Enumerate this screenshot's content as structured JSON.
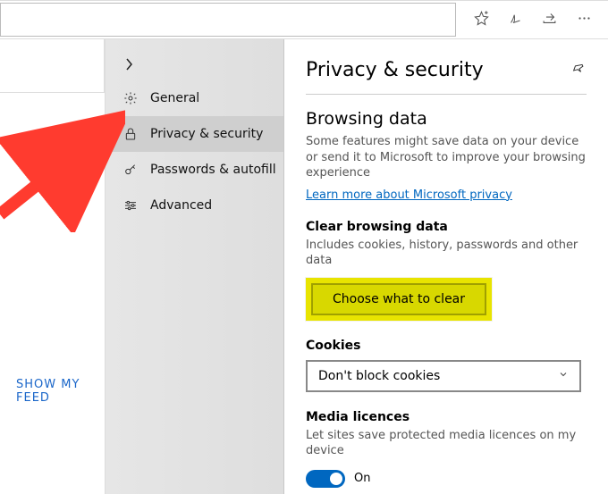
{
  "topbar": {},
  "left": {
    "show_feed": "SHOW MY FEED"
  },
  "sidebar": {
    "items": [
      {
        "label": "General"
      },
      {
        "label": "Privacy & security"
      },
      {
        "label": "Passwords & autofill"
      },
      {
        "label": "Advanced"
      }
    ]
  },
  "content": {
    "title": "Privacy & security",
    "section1": {
      "heading": "Browsing data",
      "desc": "Some features might save data on your device or send it to Microsoft to improve your browsing experience",
      "link": "Learn more about Microsoft privacy"
    },
    "clear": {
      "heading": "Clear browsing data",
      "desc": "Includes cookies, history, passwords and other data",
      "button": "Choose what to clear"
    },
    "cookies": {
      "heading": "Cookies",
      "value": "Don't block cookies"
    },
    "media": {
      "heading": "Media licences",
      "desc": "Let sites save protected media licences on my device",
      "toggle": "On"
    }
  }
}
